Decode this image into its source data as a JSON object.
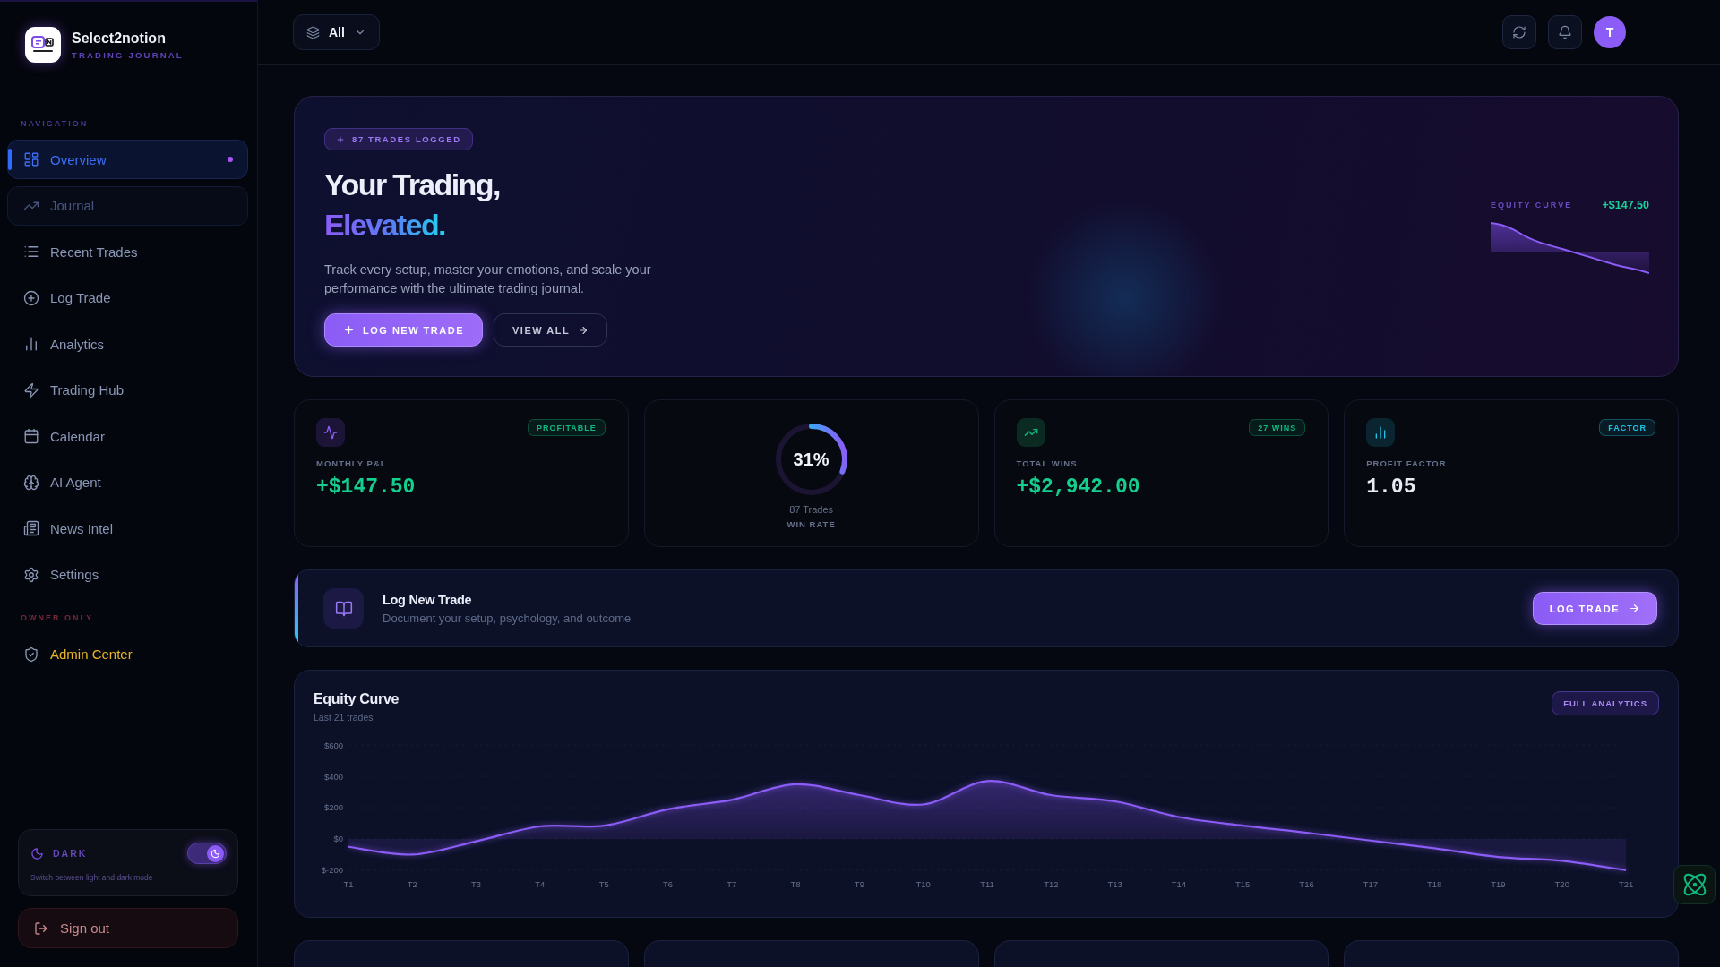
{
  "brand": {
    "name": "Select2notion",
    "tagline": "TRADING JOURNAL"
  },
  "sidebar": {
    "section_label": "NAVIGATION",
    "items": [
      {
        "label": "Overview",
        "selected": true,
        "disabled": false
      },
      {
        "label": "Journal",
        "selected": false,
        "disabled": true
      },
      {
        "label": "Recent Trades",
        "selected": false,
        "disabled": false
      },
      {
        "label": "Log Trade",
        "selected": false,
        "disabled": false
      },
      {
        "label": "Analytics",
        "selected": false,
        "disabled": false
      },
      {
        "label": "Trading Hub",
        "selected": false,
        "disabled": false
      },
      {
        "label": "Calendar",
        "selected": false,
        "disabled": false
      },
      {
        "label": "AI Agent",
        "selected": false,
        "disabled": false
      },
      {
        "label": "News Intel",
        "selected": false,
        "disabled": false
      },
      {
        "label": "Settings",
        "selected": false,
        "disabled": false
      }
    ],
    "owner_section_label": "OWNER ONLY",
    "owner_items": [
      {
        "label": "Admin Center",
        "selected": false
      }
    ],
    "theme_toggle": {
      "label": "DARK",
      "hint": "Switch between light and dark mode",
      "on": true
    },
    "sign_out": "Sign out"
  },
  "header": {
    "filter": "All",
    "avatar": "T"
  },
  "hero": {
    "badge": "87 TRADES LOGGED",
    "title": "Your Trading,",
    "highlight": "Elevated.",
    "description": "Track every setup, master your emotions, and scale your performance with the ultimate trading journal.",
    "buttons": [
      {
        "label": "LOG NEW TRADE",
        "kind": "primary"
      },
      {
        "label": "VIEW ALL",
        "kind": "secondary"
      }
    ],
    "equity": {
      "label": "EQUITY CURVE",
      "value": "+$147.50"
    }
  },
  "stats": [
    {
      "kind": "metric",
      "label": "MONTHLY P&L",
      "value": "+$147.50",
      "badge": "PROFITABLE",
      "color": "#10b981",
      "positive": true
    },
    {
      "kind": "ring",
      "percent": "31%",
      "level": 0.31,
      "caption": "87 Trades",
      "label": "WIN RATE"
    },
    {
      "kind": "metric",
      "label": "TOTAL WINS",
      "value": "+$2,942.00",
      "badge": "27 WINS",
      "color": "#10b981",
      "positive": true
    },
    {
      "kind": "metric",
      "label": "PROFIT FACTOR",
      "value": "1.05",
      "badge": "FACTOR",
      "color": "#22c3e6",
      "positive": false
    }
  ],
  "action_banner": {
    "title": "Log New Trade",
    "subtitle": "Document your setup, psychology, and outcome",
    "button": "LOG TRADE"
  },
  "equity_chart": {
    "title": "Equity Curve",
    "subtitle": "Last 21 trades",
    "button": "FULL ANALYTICS",
    "chart_data": {
      "type": "area",
      "categories": [
        "T1",
        "T2",
        "T3",
        "T4",
        "T5",
        "T6",
        "T7",
        "T8",
        "T9",
        "T10",
        "T11",
        "T12",
        "T13",
        "T14",
        "T15",
        "T16",
        "T17",
        "T18",
        "T19",
        "T20",
        "T21"
      ],
      "values": [
        -50,
        -100,
        -15,
        80,
        85,
        190,
        250,
        350,
        280,
        220,
        370,
        280,
        240,
        140,
        85,
        40,
        -10,
        -60,
        -115,
        -140,
        -200
      ],
      "ylim": [
        -200,
        600
      ],
      "yticks": [
        {
          "value": 600,
          "label": "$600"
        },
        {
          "value": 400,
          "label": "$400"
        },
        {
          "value": 200,
          "label": "$200"
        },
        {
          "value": 0,
          "label": "$0"
        },
        {
          "value": -200,
          "label": "$-200"
        }
      ],
      "grid": true
    }
  }
}
